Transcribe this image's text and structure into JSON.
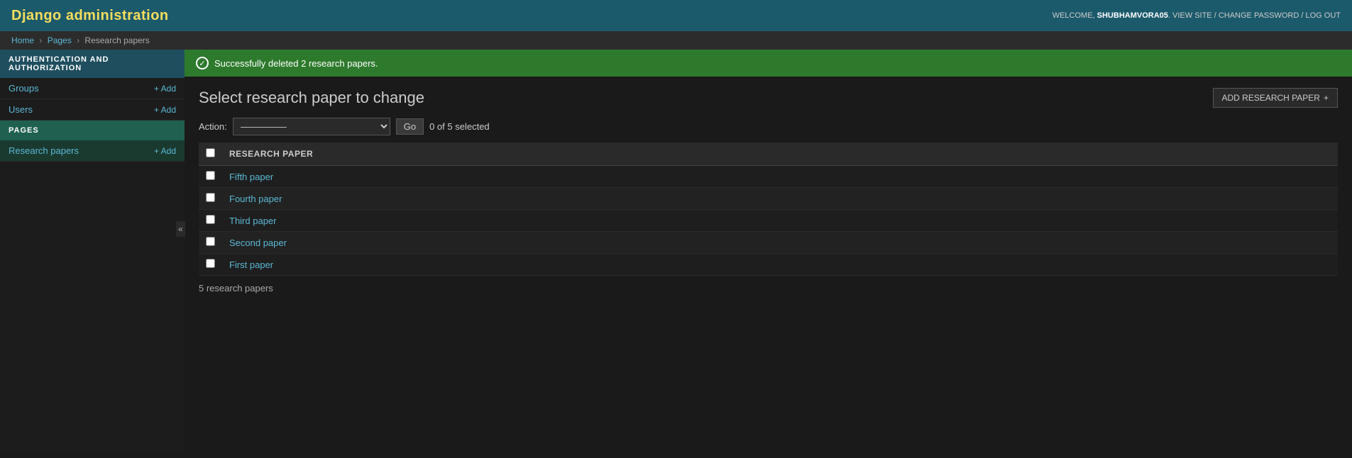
{
  "header": {
    "title": "Django administration",
    "welcome_text": "WELCOME,",
    "username": "SHUBHAMVORA05",
    "view_site_label": "VIEW SITE",
    "change_password_label": "CHANGE PASSWORD",
    "log_out_label": "LOG OUT"
  },
  "breadcrumb": {
    "home": "Home",
    "pages": "Pages",
    "current": "Research papers"
  },
  "success_message": "Successfully deleted 2 research papers.",
  "sidebar": {
    "sections": [
      {
        "title": "AUTHENTICATION AND AUTHORIZATION",
        "items": [
          {
            "label": "Groups",
            "add_label": "+ Add"
          },
          {
            "label": "Users",
            "add_label": "+ Add"
          }
        ]
      },
      {
        "title": "PAGES",
        "items": [
          {
            "label": "Research papers",
            "add_label": "+ Add"
          }
        ]
      }
    ]
  },
  "nav_toggle": "«",
  "content": {
    "title": "Select research paper to change",
    "add_button_label": "ADD RESEARCH PAPER",
    "add_button_icon": "+",
    "actions": {
      "label": "Action:",
      "default_option": "—————",
      "go_label": "Go",
      "selected_count": "0 of 5 selected"
    },
    "table": {
      "columns": [
        {
          "key": "checkbox",
          "label": ""
        },
        {
          "key": "name",
          "label": "RESEARCH PAPER"
        }
      ],
      "rows": [
        {
          "label": "Fifth paper"
        },
        {
          "label": "Fourth paper"
        },
        {
          "label": "Third paper"
        },
        {
          "label": "Second paper"
        },
        {
          "label": "First paper"
        }
      ]
    },
    "result_count": "5 research papers"
  },
  "colors": {
    "header_bg": "#1b5a6b",
    "title_color": "#f5dd5d",
    "sidebar_auth_bg": "#1f4e5f",
    "sidebar_pages_bg": "#1f6050",
    "success_bg": "#2d7a2d",
    "link_color": "#5bb8d4"
  }
}
